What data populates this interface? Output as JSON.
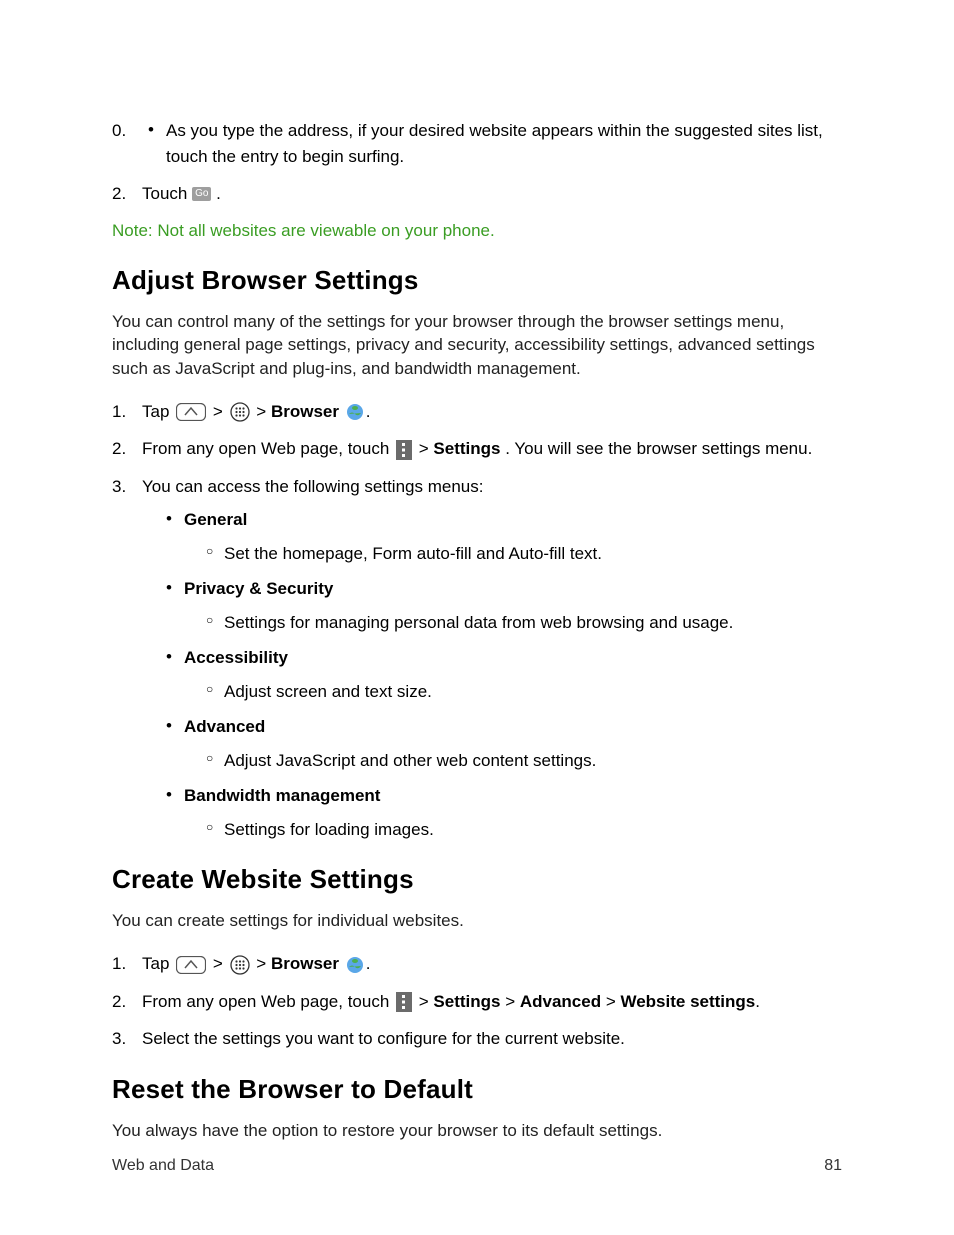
{
  "topList": {
    "bullet1": "As you type the address, if your desired website appears within the suggested sites list, touch the entry to begin surfing.",
    "step2_pre": "Touch ",
    "step2_go": "Go",
    "step2_post": "."
  },
  "note": "Note: Not all websites are viewable on your phone.",
  "sec1": {
    "title": "Adjust Browser Settings",
    "intro": "You can control many of the settings for your browser through the browser settings menu, including general page settings, privacy and security, accessibility settings, advanced settings such as JavaScript and plug-ins, and bandwidth management.",
    "step1_pre": "Tap ",
    "step1_gt1": ">",
    "step1_gt2": ">",
    "step1_browser": "Browser",
    "step1_post": ".",
    "step2_pre": "From any open Web page, touch ",
    "step2_gt": "> ",
    "step2_settings": "Settings",
    "step2_post": ". You will see the browser settings menu.",
    "step3": "You can access the following settings menus:",
    "menus": {
      "general": {
        "label": "General",
        "desc": "Set the homepage, Form auto-fill and Auto-fill text."
      },
      "privacy": {
        "label": "Privacy & Security",
        "desc": "Settings for managing personal data from web browsing and usage."
      },
      "accessibility": {
        "label": "Accessibility",
        "desc": "Adjust screen and text size."
      },
      "advanced": {
        "label": "Advanced",
        "desc": "Adjust JavaScript and other web content settings."
      },
      "bandwidth": {
        "label": "Bandwidth management",
        "desc": "Settings for loading images."
      }
    }
  },
  "sec2": {
    "title": "Create Website Settings",
    "intro": "You can create settings for individual websites.",
    "step1_pre": "Tap ",
    "step1_gt1": ">",
    "step1_gt2": ">",
    "step1_browser": "Browser",
    "step1_post": ".",
    "step2_pre": "From any open Web page, touch ",
    "step2_gt1": "> ",
    "step2_settings": "Settings",
    "step2_gt2": " > ",
    "step2_advanced": "Advanced",
    "step2_gt3": " > ",
    "step2_website": "Website settings",
    "step2_post": ".",
    "step3": "Select the settings you want to configure for the current website."
  },
  "sec3": {
    "title": "Reset the Browser to Default",
    "intro": "You always have the option to restore your browser to its default settings."
  },
  "footer": {
    "left": "Web and Data",
    "right": "81"
  }
}
